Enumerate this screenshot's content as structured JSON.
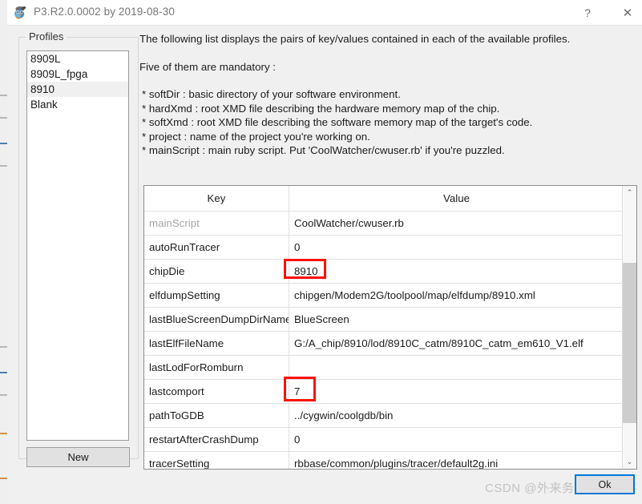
{
  "window": {
    "title": "P3.R2.0.0002 by 2019-08-30",
    "app_icon": "bird-icon",
    "help_label": "?",
    "close_label": "✕"
  },
  "profiles": {
    "legend": "Profiles",
    "items": [
      {
        "label": "8909L",
        "selected": false
      },
      {
        "label": "8909L_fpga",
        "selected": false
      },
      {
        "label": "8910",
        "selected": true
      },
      {
        "label": "Blank",
        "selected": false
      }
    ],
    "new_button": "New"
  },
  "description": {
    "lines": [
      "The following list displays the pairs of key/values contained in each of the available profiles.",
      "",
      "Five of them are mandatory :",
      "",
      " * softDir : basic directory of your software environment.",
      " * hardXmd : root XMD file describing the hardware memory map of the chip.",
      " * softXmd : root XMD file describing the software memory map of the target's code.",
      " * project : name of the project you're working on.",
      " * mainScript : main ruby script. Put 'CoolWatcher/cwuser.rb' if you're puzzled."
    ]
  },
  "table": {
    "headers": [
      "Key",
      "Value"
    ],
    "rows": [
      {
        "key": "mainScript",
        "value": "CoolWatcher/cwuser.rb",
        "key_dim": true
      },
      {
        "key": "autoRunTracer",
        "value": "0",
        "key_dim": false
      },
      {
        "key": "chipDie",
        "value": "8910",
        "key_dim": false
      },
      {
        "key": "elfdumpSetting",
        "value": "chipgen/Modem2G/toolpool/map/elfdump/8910.xml",
        "key_dim": false
      },
      {
        "key": "lastBlueScreenDumpDirName",
        "value": "BlueScreen",
        "key_dim": false
      },
      {
        "key": "lastElfFileName",
        "value": "G:/A_chip/8910/lod/8910C_catm/8910C_catm_em610_V1.elf",
        "key_dim": false
      },
      {
        "key": "lastLodForRomburn",
        "value": "",
        "key_dim": false
      },
      {
        "key": "lastcomport",
        "value": "7",
        "key_dim": false
      },
      {
        "key": "pathToGDB",
        "value": "../cygwin/coolgdb/bin",
        "key_dim": false
      },
      {
        "key": "restartAfterCrashDump",
        "value": "0",
        "key_dim": false
      },
      {
        "key": "tracerSetting",
        "value": "rbbase/common/plugins/tracer/default2g.ini",
        "key_dim": false
      }
    ],
    "scrollbar": {
      "up_arrow": "⌃",
      "down_arrow": "⌄"
    }
  },
  "annotations": {
    "color": "#fa1202",
    "boxes": [
      "chipDie-value-highlight",
      "lastcomport-value-highlight"
    ]
  },
  "footer": {
    "ok_button": "Ok",
    "watermark": "CSDN @外来务工人员陈某"
  }
}
